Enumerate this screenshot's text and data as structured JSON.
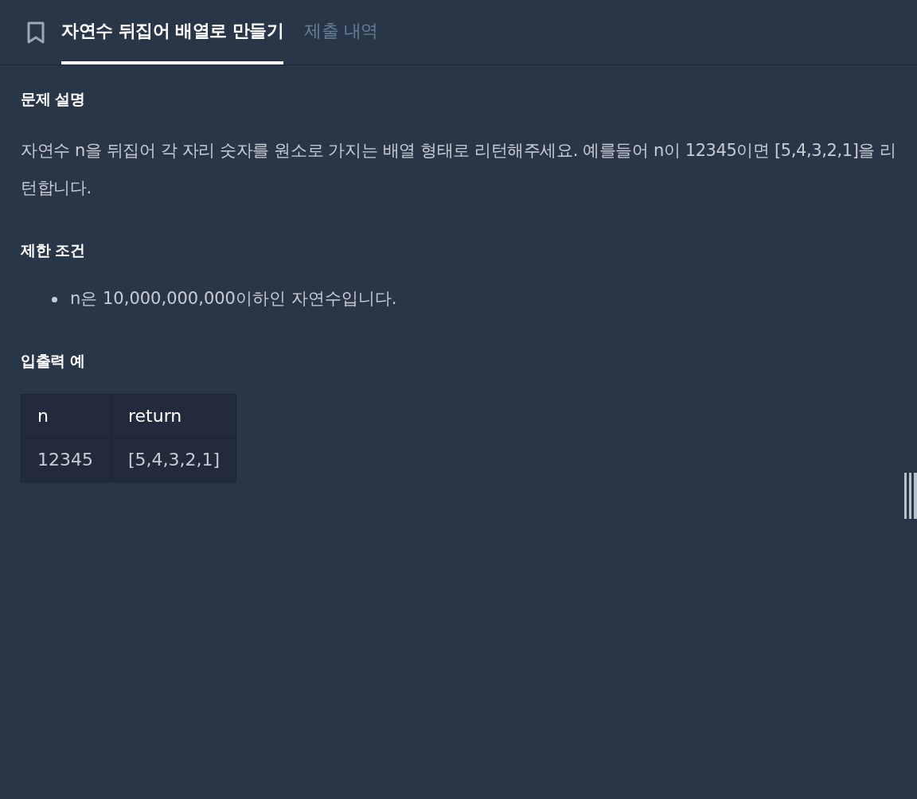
{
  "tabs": [
    {
      "label": "자연수 뒤집어 배열로 만들기",
      "selected": true
    },
    {
      "label": "제출 내역",
      "selected": false
    }
  ],
  "sections": [
    {
      "heading": "문제 설명",
      "kind": "paragraph",
      "text": "자연수 n을 뒤집어 각 자리 숫자를 원소로 가지는 배열 형태로 리턴해주세요. 예를들어 n이 12345이면 [5,4,3,2,1]을 리턴합니다."
    },
    {
      "heading": "제한 조건",
      "kind": "bullets",
      "items": [
        "n은 10,000,000,000이하인 자연수입니다."
      ]
    },
    {
      "heading": "입출력 예",
      "kind": "table",
      "columns": [
        "n",
        "return"
      ],
      "rows": [
        [
          "12345",
          "[5,4,3,2,1]"
        ]
      ]
    }
  ]
}
